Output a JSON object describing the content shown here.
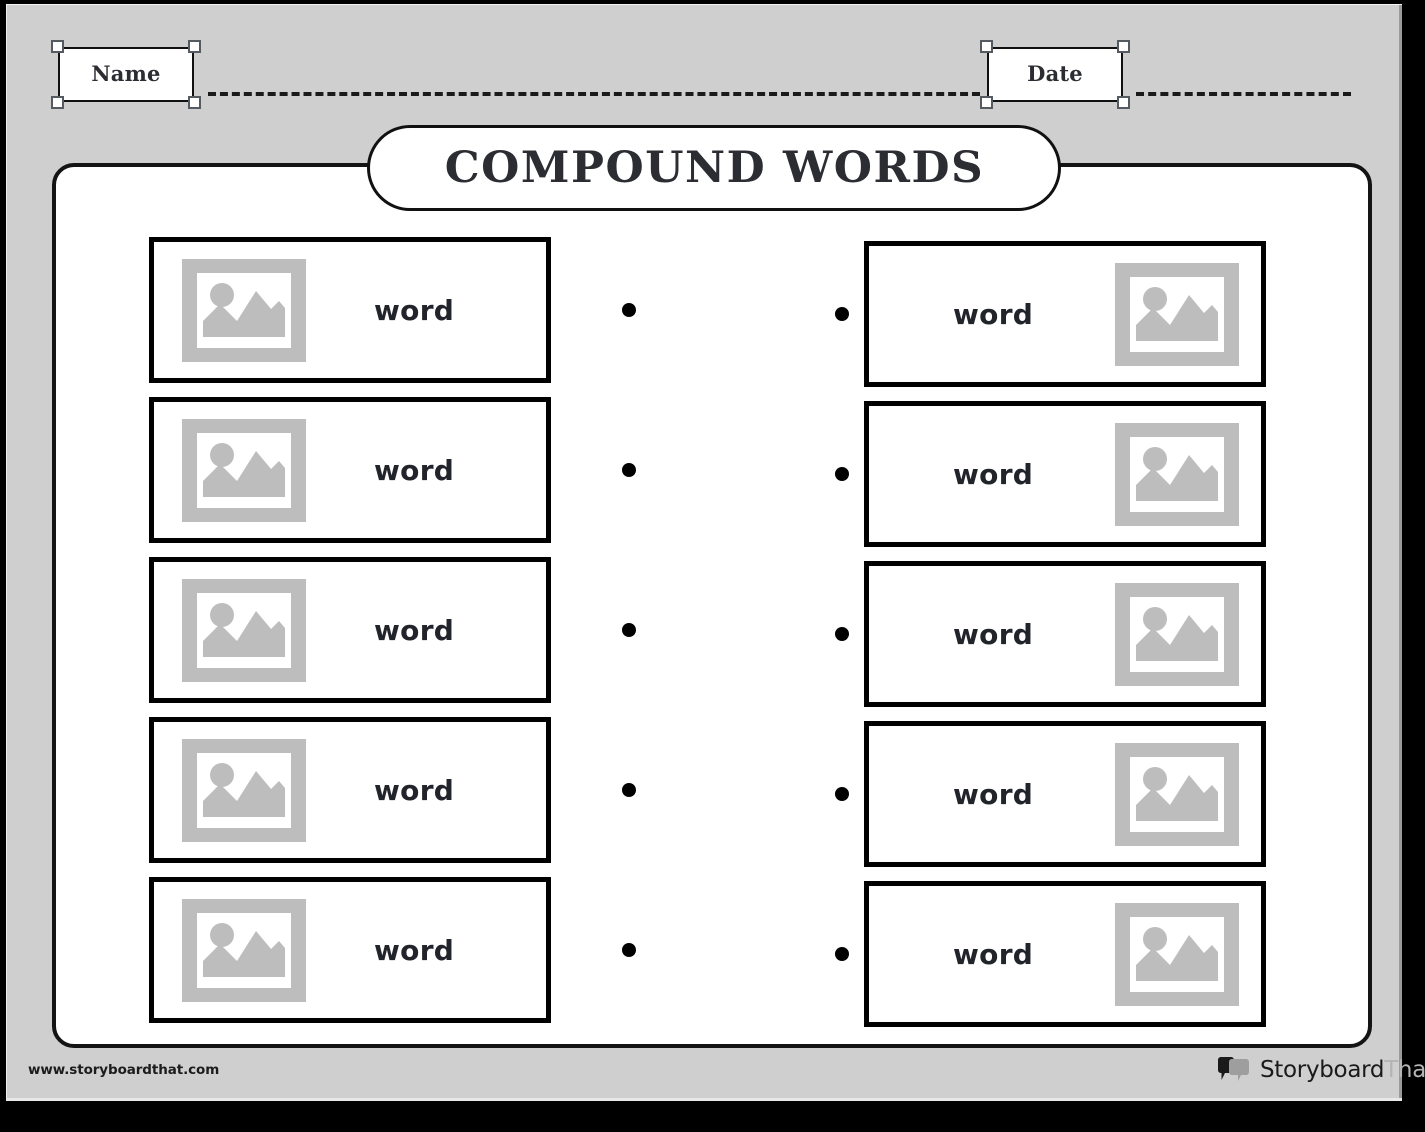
{
  "document": {
    "title": "COMPOUND WORDS",
    "background_color": "#cfcfcf",
    "panel_color": "#ffffff",
    "ink_color": "#111111",
    "placeholder_color": "#bdbdbd"
  },
  "header": {
    "name_field": {
      "label": "Name",
      "icon": "selection-handles",
      "value": "",
      "placeholder": ""
    },
    "date_field": {
      "label": "Date",
      "icon": "selection-handles",
      "value": "",
      "placeholder": ""
    }
  },
  "worksheet": {
    "rows": [
      {
        "left": {
          "word": "word",
          "image": "image-placeholder-icon",
          "dot": "connector-dot"
        },
        "right": {
          "word": "word",
          "image": "image-placeholder-icon",
          "dot": "connector-dot"
        }
      },
      {
        "left": {
          "word": "word",
          "image": "image-placeholder-icon",
          "dot": "connector-dot"
        },
        "right": {
          "word": "word",
          "image": "image-placeholder-icon",
          "dot": "connector-dot"
        }
      },
      {
        "left": {
          "word": "word",
          "image": "image-placeholder-icon",
          "dot": "connector-dot"
        },
        "right": {
          "word": "word",
          "image": "image-placeholder-icon",
          "dot": "connector-dot"
        }
      },
      {
        "left": {
          "word": "word",
          "image": "image-placeholder-icon",
          "dot": "connector-dot"
        },
        "right": {
          "word": "word",
          "image": "image-placeholder-icon",
          "dot": "connector-dot"
        }
      },
      {
        "left": {
          "word": "word",
          "image": "image-placeholder-icon",
          "dot": "connector-dot"
        },
        "right": {
          "word": "word",
          "image": "image-placeholder-icon",
          "dot": "connector-dot"
        }
      }
    ]
  },
  "footer": {
    "url": "www.storyboardthat.com",
    "brand_name": "Storyboard",
    "brand_suffix": "That",
    "brand_icon": "speech-bubbles-icon"
  }
}
